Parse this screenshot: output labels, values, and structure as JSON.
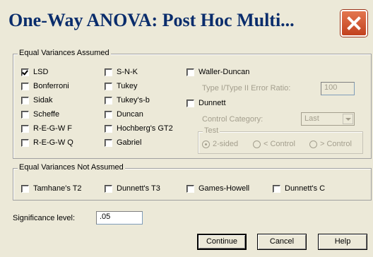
{
  "window": {
    "title": "One-Way ANOVA: Post Hoc Multi..."
  },
  "equal_assumed": {
    "legend": "Equal Variances Assumed",
    "col1": [
      {
        "label": "LSD",
        "checked": true
      },
      {
        "label": "Bonferroni",
        "checked": false
      },
      {
        "label": "Sidak",
        "checked": false
      },
      {
        "label": "Scheffe",
        "checked": false
      },
      {
        "label": "R-E-G-W F",
        "checked": false
      },
      {
        "label": "R-E-G-W Q",
        "checked": false
      }
    ],
    "col2": [
      {
        "label": "S-N-K",
        "checked": false
      },
      {
        "label": "Tukey",
        "checked": false
      },
      {
        "label": "Tukey's-b",
        "checked": false
      },
      {
        "label": "Duncan",
        "checked": false
      },
      {
        "label": "Hochberg's GT2",
        "checked": false
      },
      {
        "label": "Gabriel",
        "checked": false
      }
    ],
    "waller_duncan": "Waller-Duncan",
    "error_ratio_label": "Type I/Type II Error Ratio:",
    "error_ratio_value": "100",
    "dunnett": "Dunnett",
    "control_category_label": "Control Category:",
    "control_category_value": "Last",
    "test_legend": "Test",
    "test_options": [
      "2-sided",
      "< Control",
      "> Control"
    ]
  },
  "equal_not_assumed": {
    "legend": "Equal Variances Not Assumed",
    "options": [
      "Tamhane's T2",
      "Dunnett's T3",
      "Games-Howell",
      "Dunnett's C"
    ]
  },
  "significance": {
    "label": "Significance level:",
    "value": ".05"
  },
  "buttons": {
    "continue": "Continue",
    "cancel": "Cancel",
    "help": "Help"
  }
}
